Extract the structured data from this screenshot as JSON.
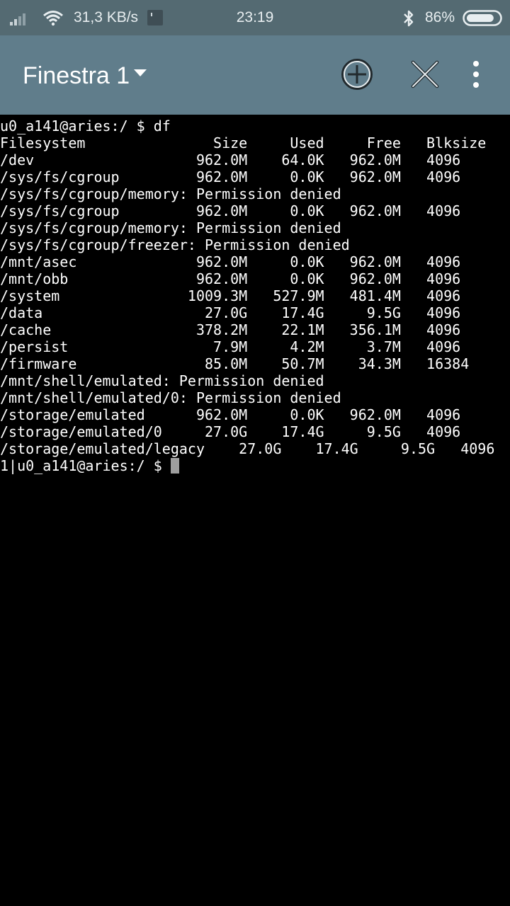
{
  "status_bar": {
    "network_speed": "31,3 KB/s",
    "time": "23:19",
    "battery_percent": "86%",
    "battery_level": 0.86,
    "icons": [
      "signal-icon",
      "wifi-icon",
      "notification-icon",
      "bluetooth-icon",
      "battery-icon"
    ]
  },
  "toolbar": {
    "window_title": "Finestra 1",
    "icons": [
      "dropdown-caret-icon",
      "add-circle-icon",
      "close-icon",
      "overflow-menu-icon"
    ]
  },
  "terminal": {
    "lines": [
      "u0_a141@aries:/ $ df",
      "Filesystem               Size     Used     Free   Blksize",
      "/dev                   962.0M    64.0K   962.0M   4096",
      "/sys/fs/cgroup         962.0M     0.0K   962.0M   4096",
      "/sys/fs/cgroup/memory: Permission denied",
      "/sys/fs/cgroup         962.0M     0.0K   962.0M   4096",
      "/sys/fs/cgroup/memory: Permission denied",
      "/sys/fs/cgroup/freezer: Permission denied",
      "/mnt/asec              962.0M     0.0K   962.0M   4096",
      "/mnt/obb               962.0M     0.0K   962.0M   4096",
      "/system               1009.3M   527.9M   481.4M   4096",
      "/data                   27.0G    17.4G     9.5G   4096",
      "/cache                 378.2M    22.1M   356.1M   4096",
      "/persist                 7.9M     4.2M     3.7M   4096",
      "/firmware               85.0M    50.7M    34.3M   16384",
      "/mnt/shell/emulated: Permission denied",
      "/mnt/shell/emulated/0: Permission denied",
      "/storage/emulated      962.0M     0.0K   962.0M   4096",
      "/storage/emulated/0     27.0G    17.4G     9.5G   4096",
      "/storage/emulated/legacy    27.0G    17.4G     9.5G   4096"
    ],
    "prompt": "1|u0_a141@aries:/ $ "
  }
}
